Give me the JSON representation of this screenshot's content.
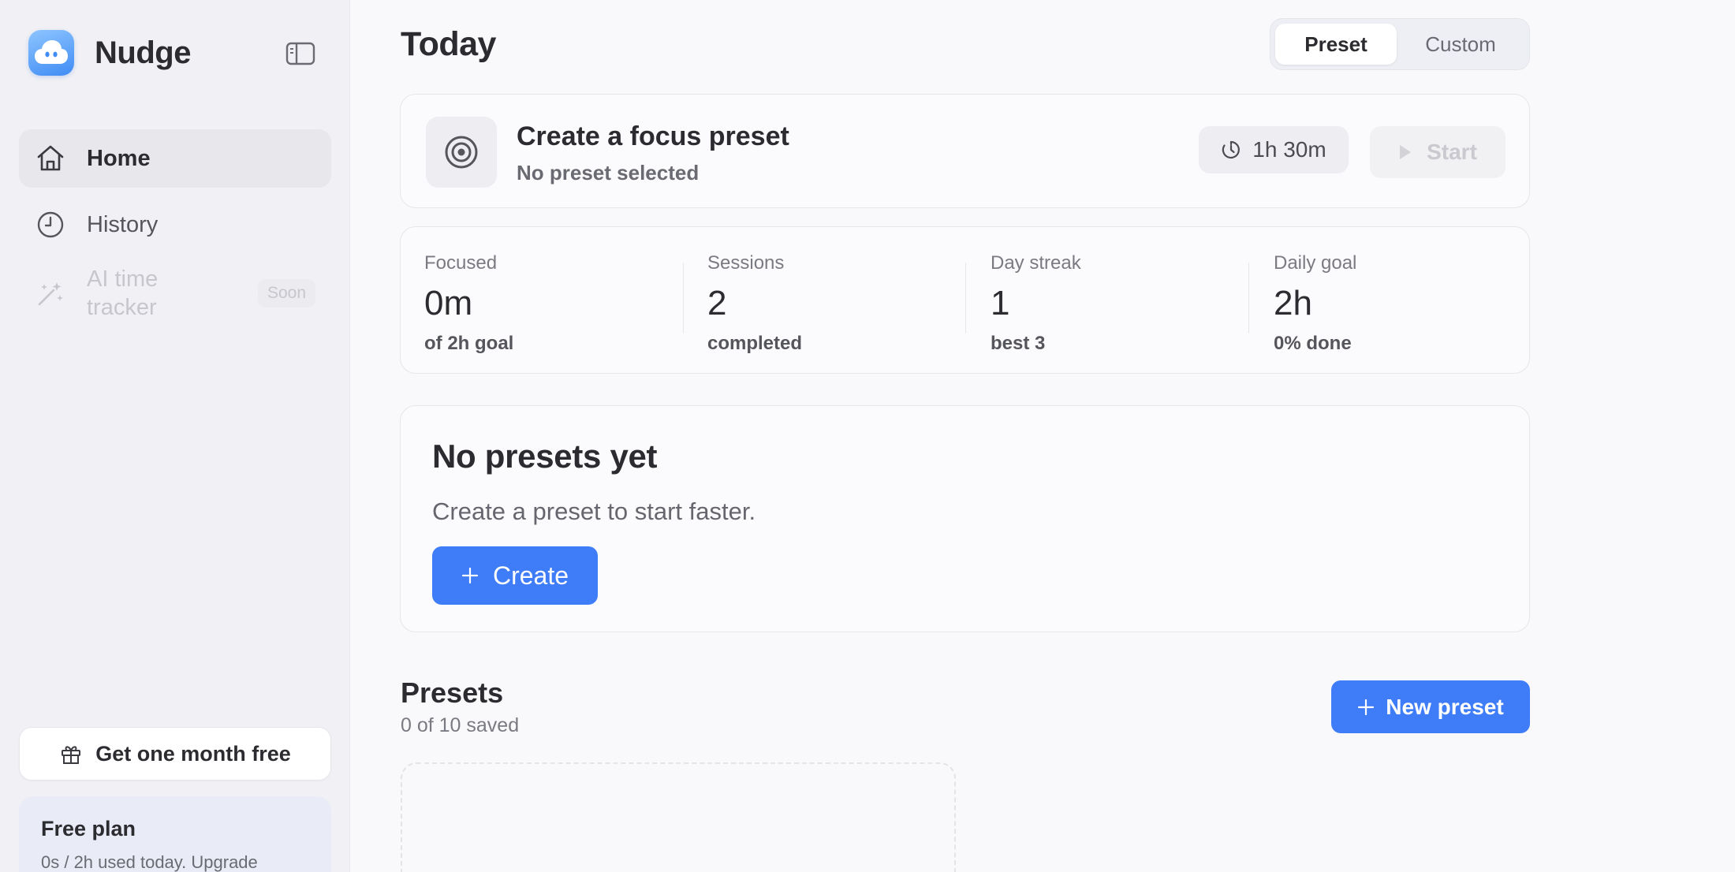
{
  "sidebar": {
    "app_name": "Nudge",
    "nav": [
      {
        "label": "Home",
        "icon": "home-icon",
        "active": true
      },
      {
        "label": "History",
        "icon": "clock-icon",
        "active": false
      },
      {
        "label": "AI time tracker",
        "icon": "magic-wand-icon",
        "disabled": true,
        "badge": "Soon"
      }
    ],
    "referral_label": "Get one month free",
    "plan": {
      "title": "Free plan",
      "usage": "0s / 2h used today. Upgrade"
    }
  },
  "header": {
    "title": "Today",
    "modes": [
      "Preset",
      "Custom"
    ],
    "selected_mode": "Preset"
  },
  "focus": {
    "title": "Create a focus preset",
    "subtitle": "No preset selected",
    "duration": "1h 30m",
    "start_label": "Start"
  },
  "stats": [
    {
      "label": "Focused",
      "value": "0m",
      "sub": "of 2h goal"
    },
    {
      "label": "Sessions",
      "value": "2",
      "sub": "completed"
    },
    {
      "label": "Day streak",
      "value": "1",
      "sub": "best 3"
    },
    {
      "label": "Daily goal",
      "value": "2h",
      "sub": "0% done"
    }
  ],
  "empty_state": {
    "title": "No presets yet",
    "description": "Create a preset to start faster.",
    "button_label": "Create"
  },
  "presets": {
    "title": "Presets",
    "count": "0 of 10 saved",
    "new_label": "New preset"
  },
  "colors": {
    "accent": "#3f7cf7",
    "sidebar_bg": "#f1f1f5",
    "page_bg": "#f9f9fb",
    "plan_bg": "#e9ebf7"
  }
}
